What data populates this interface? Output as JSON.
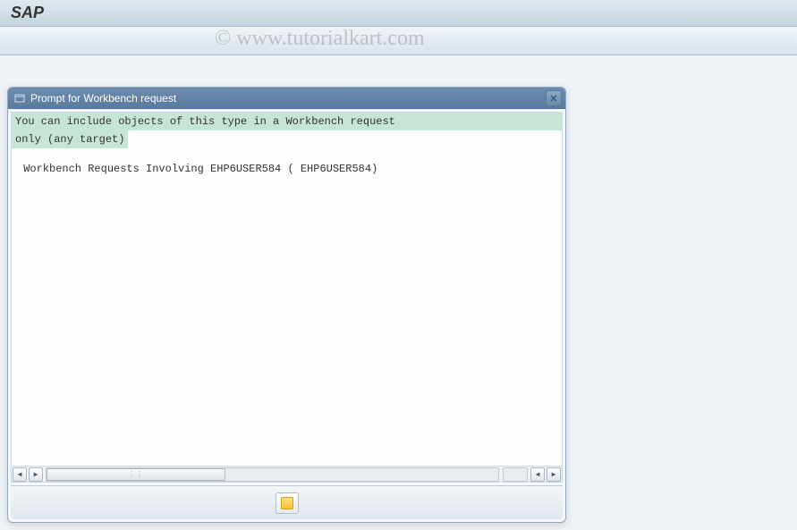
{
  "header": {
    "title": "SAP"
  },
  "watermark": "© www.tutorialkart.com",
  "dialog": {
    "title": "Prompt for Workbench request",
    "info_line1": "You can include objects of this type in a Workbench request",
    "info_line2": "only (any target)",
    "body_line": " Workbench Requests Involving EHP6USER584 ( EHP6USER584)"
  }
}
